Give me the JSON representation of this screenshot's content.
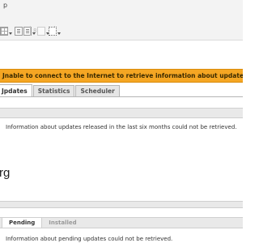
{
  "toolbar": {
    "menu_glyph": "p",
    "faint_label": "8"
  },
  "alert": {
    "message": "Jnable to connect to the Internet to retrieve information about updates, news and comm"
  },
  "tabs": [
    {
      "label": "Jpdates",
      "active": true
    },
    {
      "label": "Statistics",
      "active": false
    },
    {
      "label": "Scheduler",
      "active": false
    }
  ],
  "updates_section": {
    "message": "Information about updates released in the last six months could not be retrieved."
  },
  "partial_glyph": "rg",
  "pending_section": {
    "tabs": [
      {
        "label": "Pending",
        "active": true
      },
      {
        "label": "Installed",
        "active": false
      }
    ],
    "message": "Information about pending updates could not be retrieved."
  }
}
